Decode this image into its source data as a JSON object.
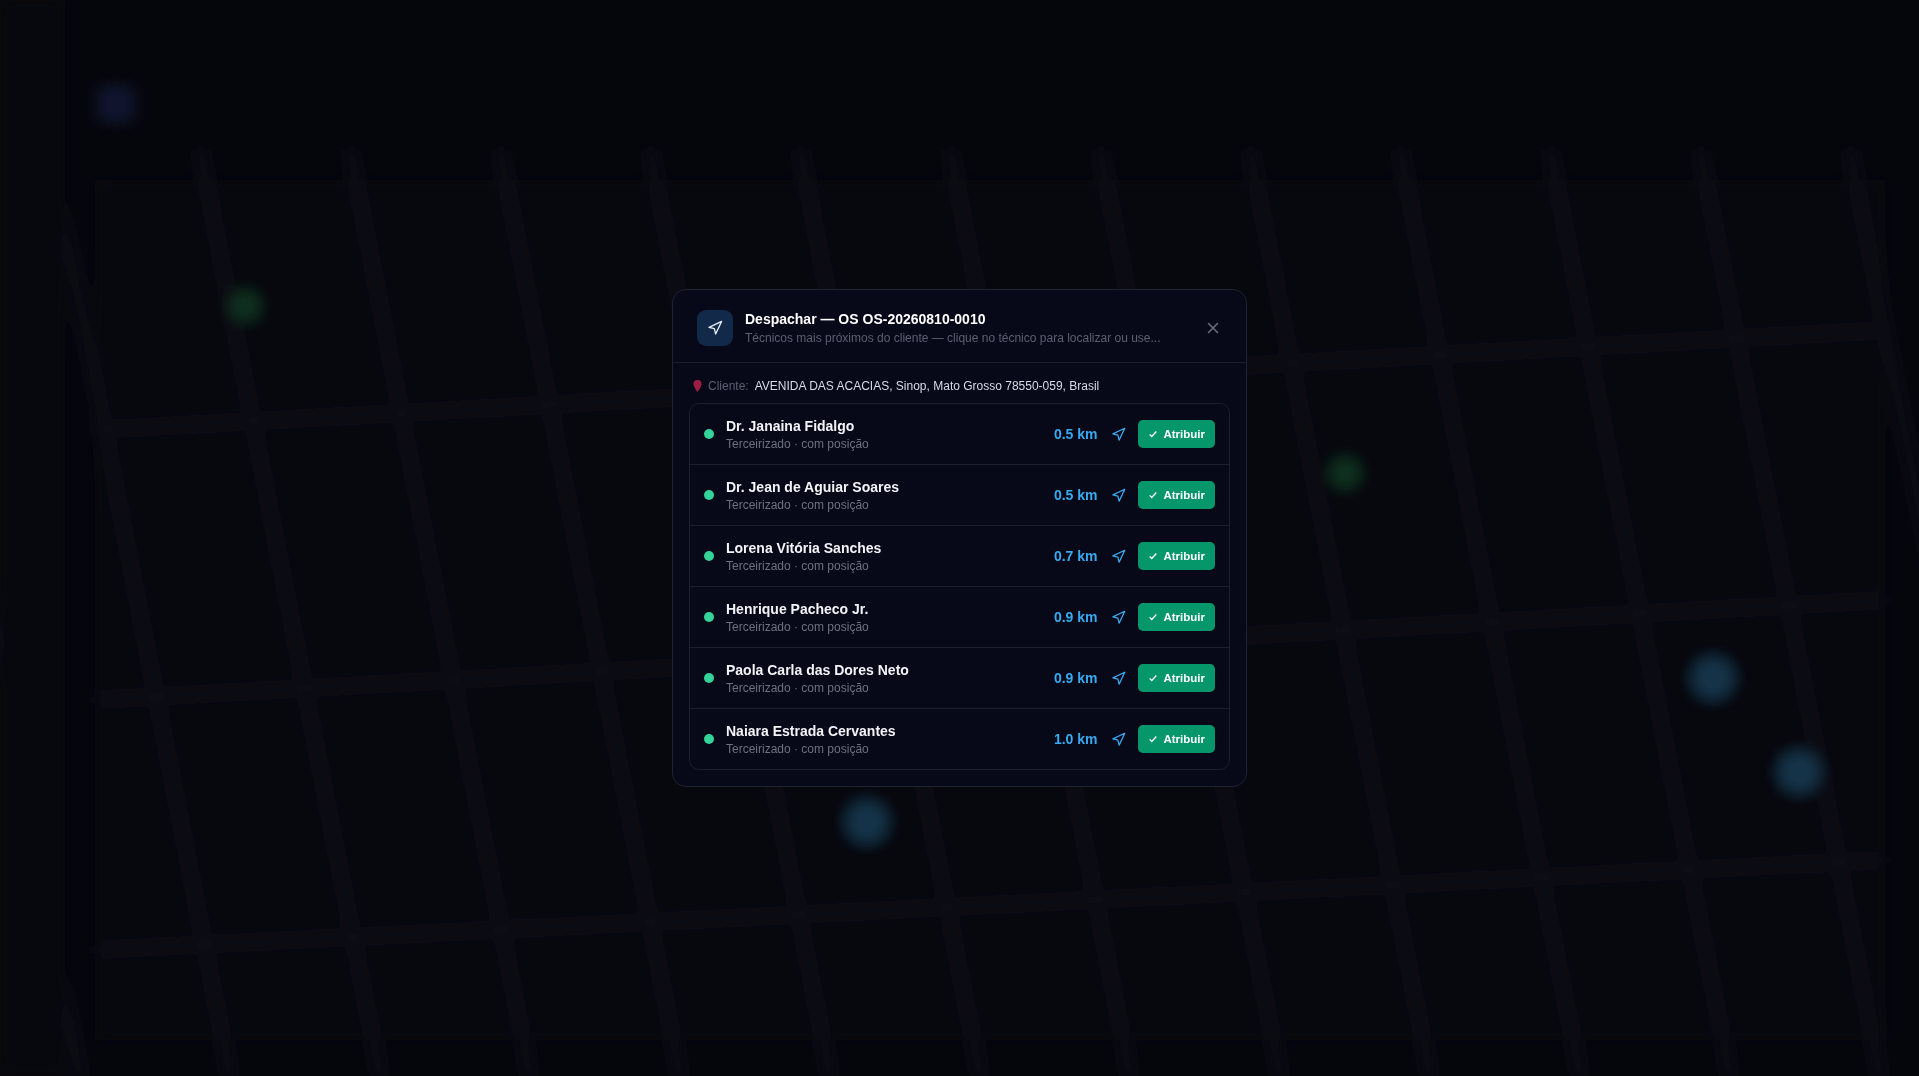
{
  "dialog": {
    "title": "Despachar — OS OS-20260810-0010",
    "subtitle": "Técnicos mais próximos do cliente — clique no técnico para localizar ou use...",
    "client_label": "Cliente:",
    "client_address": "AVENIDA DAS ACACIAS, Sinop, Mato Grosso 78550-059, Brasil",
    "technicians": [
      {
        "name": "Dr. Janaina Fidalgo",
        "detail": "Terceirizado · com posição",
        "distance": "0.5 km",
        "color": "#34d399",
        "action": "Atribuir"
      },
      {
        "name": "Dr. Jean de Aguiar Soares",
        "detail": "Terceirizado · com posição",
        "distance": "0.5 km",
        "color": "#34d399",
        "action": "Atribuir"
      },
      {
        "name": "Lorena Vitória Sanches",
        "detail": "Terceirizado · com posição",
        "distance": "0.7 km",
        "color": "#34d399",
        "action": "Atribuir"
      },
      {
        "name": "Henrique Pacheco Jr.",
        "detail": "Terceirizado · com posição",
        "distance": "0.9 km",
        "color": "#34d399",
        "action": "Atribuir"
      },
      {
        "name": "Paola Carla das Dores Neto",
        "detail": "Terceirizado · com posição",
        "distance": "0.9 km",
        "color": "#34d399",
        "action": "Atribuir"
      },
      {
        "name": "Naiara Estrada Cervantes",
        "detail": "Terceirizado · com posição",
        "distance": "1.0 km",
        "color": "#34d399",
        "action": "Atribuir"
      }
    ]
  }
}
